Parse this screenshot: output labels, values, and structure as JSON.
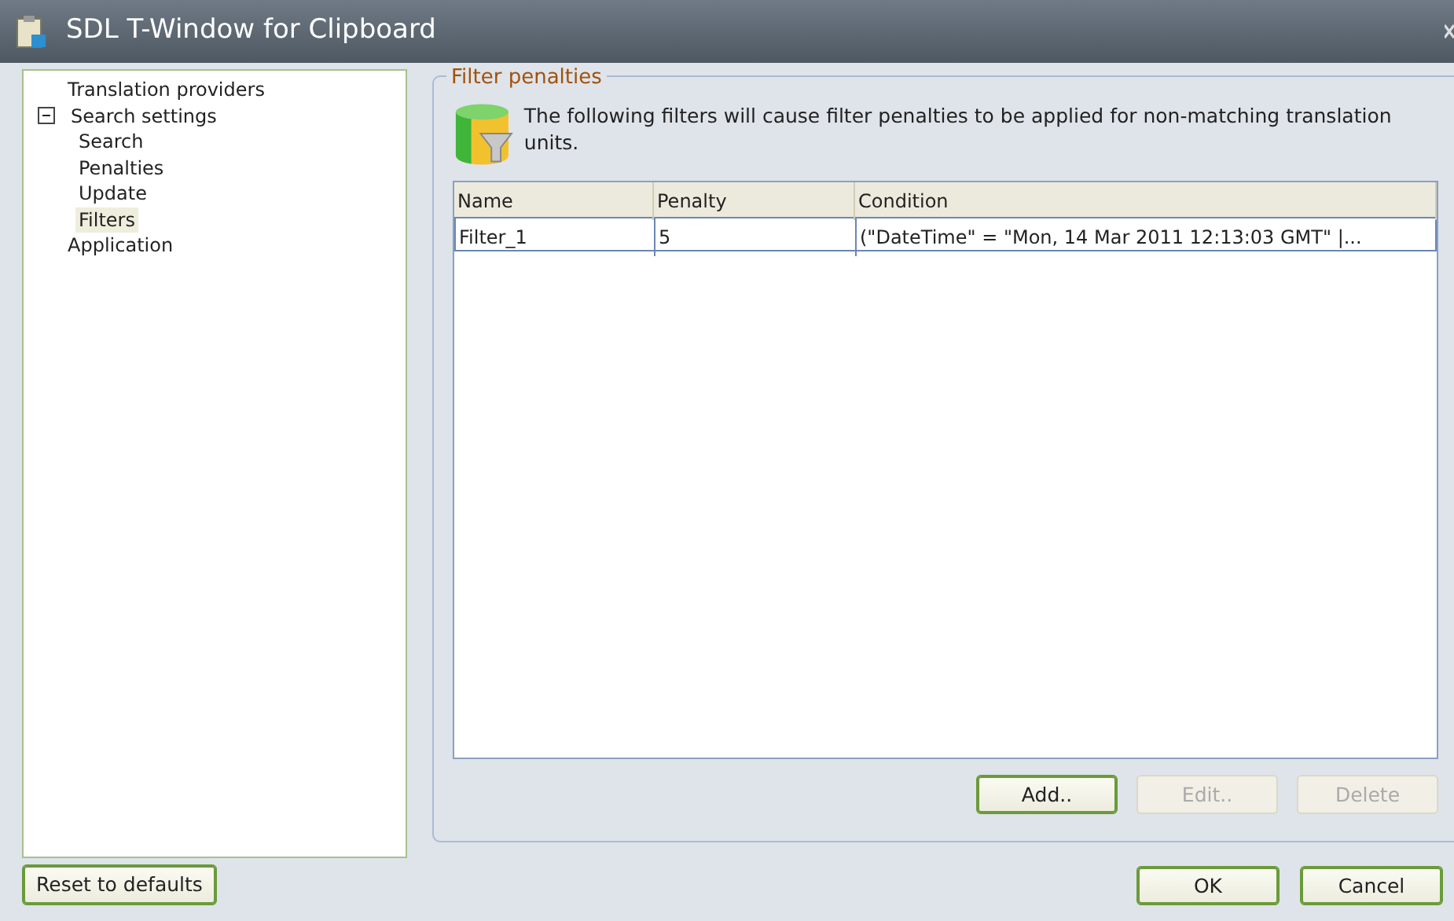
{
  "window": {
    "title": "SDL T-Window for Clipboard"
  },
  "tree": [
    {
      "label": "Translation providers",
      "selected": false
    },
    {
      "label": "Search settings",
      "selected": false,
      "expanded": true,
      "children": [
        {
          "label": "Search",
          "selected": false
        },
        {
          "label": "Penalties",
          "selected": false
        },
        {
          "label": "Update",
          "selected": false
        },
        {
          "label": "Filters",
          "selected": true
        }
      ]
    },
    {
      "label": "Application",
      "selected": false
    }
  ],
  "group": {
    "title": "Filter penalties",
    "description": "The following filters will cause filter penalties to be applied for non-matching translation units."
  },
  "table": {
    "columns": [
      "Name",
      "Penalty",
      "Condition"
    ],
    "rows": [
      {
        "cells": [
          "Filter_1",
          "5",
          "(\"DateTime\" = \"Mon, 14 Mar 2011 12:13:03 GMT\" |..."
        ],
        "selected": false
      }
    ]
  },
  "table_buttons": [
    {
      "label": "Add..",
      "disabled": false,
      "default": true
    },
    {
      "label": "Edit..",
      "disabled": true,
      "default": false
    },
    {
      "label": "Delete",
      "disabled": true,
      "default": false
    }
  ],
  "footer": {
    "reset": "Reset to defaults",
    "buttons": [
      {
        "label": "OK",
        "disabled": false
      },
      {
        "label": "Cancel",
        "disabled": false
      }
    ]
  }
}
